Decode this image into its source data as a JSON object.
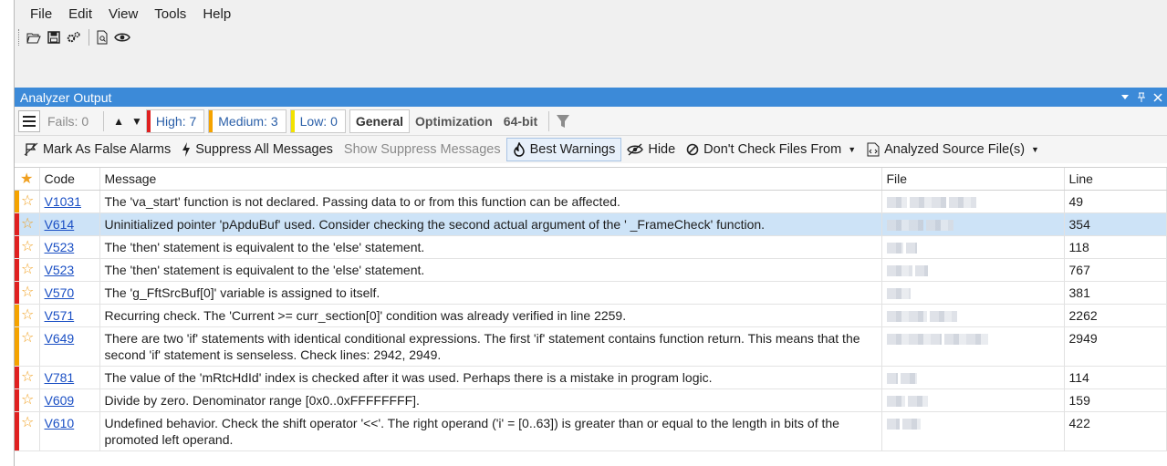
{
  "menu": [
    "File",
    "Edit",
    "View",
    "Tools",
    "Help"
  ],
  "panel": {
    "title": "Analyzer Output"
  },
  "filters": {
    "fails": "Fails: 0",
    "high": "High: 7",
    "medium": "Medium: 3",
    "low": "Low: 0",
    "tabs": [
      "General",
      "Optimization",
      "64-bit"
    ],
    "colors": {
      "high": "#e02020",
      "medium": "#f5a300",
      "low": "#f2e200"
    }
  },
  "actions": {
    "mark_false": "Mark As False Alarms",
    "suppress_all": "Suppress All Messages",
    "show_suppress": "Show Suppress Messages",
    "best_warnings": "Best Warnings",
    "hide": "Hide",
    "dont_check": "Don't Check Files From",
    "analyzed": "Analyzed Source File(s)"
  },
  "grid": {
    "headers": {
      "code": "Code",
      "message": "Message",
      "file": "File",
      "line": "Line"
    },
    "rows": [
      {
        "code": "V1031",
        "message": "The 'va_start' function is not declared. Passing data to or from this function can be affected.",
        "line": "49",
        "level": "medium"
      },
      {
        "code": "V614",
        "message": "Uninitialized pointer 'pApduBuf' used. Consider checking the second actual argument of the '        _FrameCheck' function.",
        "line": "354",
        "level": "high",
        "selected": true
      },
      {
        "code": "V523",
        "message": "The 'then' statement is equivalent to the 'else' statement.",
        "line": "118",
        "level": "high"
      },
      {
        "code": "V523",
        "message": "The 'then' statement is equivalent to the 'else' statement.",
        "line": "767",
        "level": "high"
      },
      {
        "code": "V570",
        "message": "The 'g_FftSrcBuf[0]' variable is assigned to itself.",
        "line": "381",
        "level": "high"
      },
      {
        "code": "V571",
        "message": "Recurring check. The 'Current >= curr_section[0]' condition was already verified in line 2259.",
        "line": "2262",
        "level": "medium"
      },
      {
        "code": "V649",
        "message": "There are two 'if' statements with identical conditional expressions. The first 'if' statement contains function return. This means that the second 'if' statement is senseless. Check lines: 2942, 2949.",
        "line": "2949",
        "level": "medium"
      },
      {
        "code": "V781",
        "message": "The value of the 'mRtcHdId' index is checked after it was used. Perhaps there is a mistake in program logic.",
        "line": "114",
        "level": "high"
      },
      {
        "code": "V609",
        "message": "Divide by zero. Denominator range [0x0..0xFFFFFFFF].",
        "line": "159",
        "level": "high"
      },
      {
        "code": "V610",
        "message": "Undefined behavior. Check the shift operator '<<'. The right operand ('i' = [0..63]) is greater than or equal to the length in bits of the promoted left operand.",
        "line": "422",
        "level": "high"
      }
    ]
  }
}
